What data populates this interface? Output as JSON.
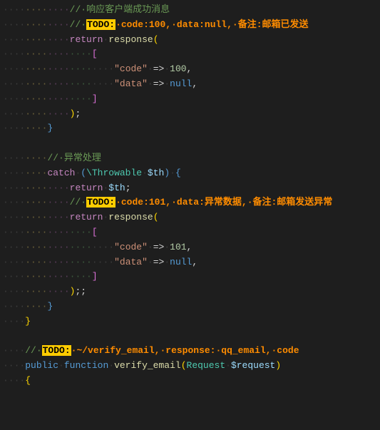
{
  "code": {
    "c1": "·响应客户端成功消息",
    "todo": "TODO:",
    "c2a": "·code:100,·data:null,·备注:邮箱已发送",
    "kw_return": "return",
    "fn_response": "response",
    "s_code": "\"code\"",
    "arrow": "=>",
    "n100": "100",
    "s_data": "\"data\"",
    "null": "null",
    "c3": "·异常处理",
    "kw_catch": "catch",
    "cls_throwable": "\\Throwable",
    "v_th": "$th",
    "c4a": "·code:101,·data:异常数据,·备注:邮箱发送异常",
    "n101": "101",
    "c5a": "·~/verify_email,·response:·qq_email,·code",
    "kw_public": "public",
    "kw_function": "function",
    "fn_verify": "verify_email",
    "cls_request": "Request",
    "v_request": "$request"
  }
}
